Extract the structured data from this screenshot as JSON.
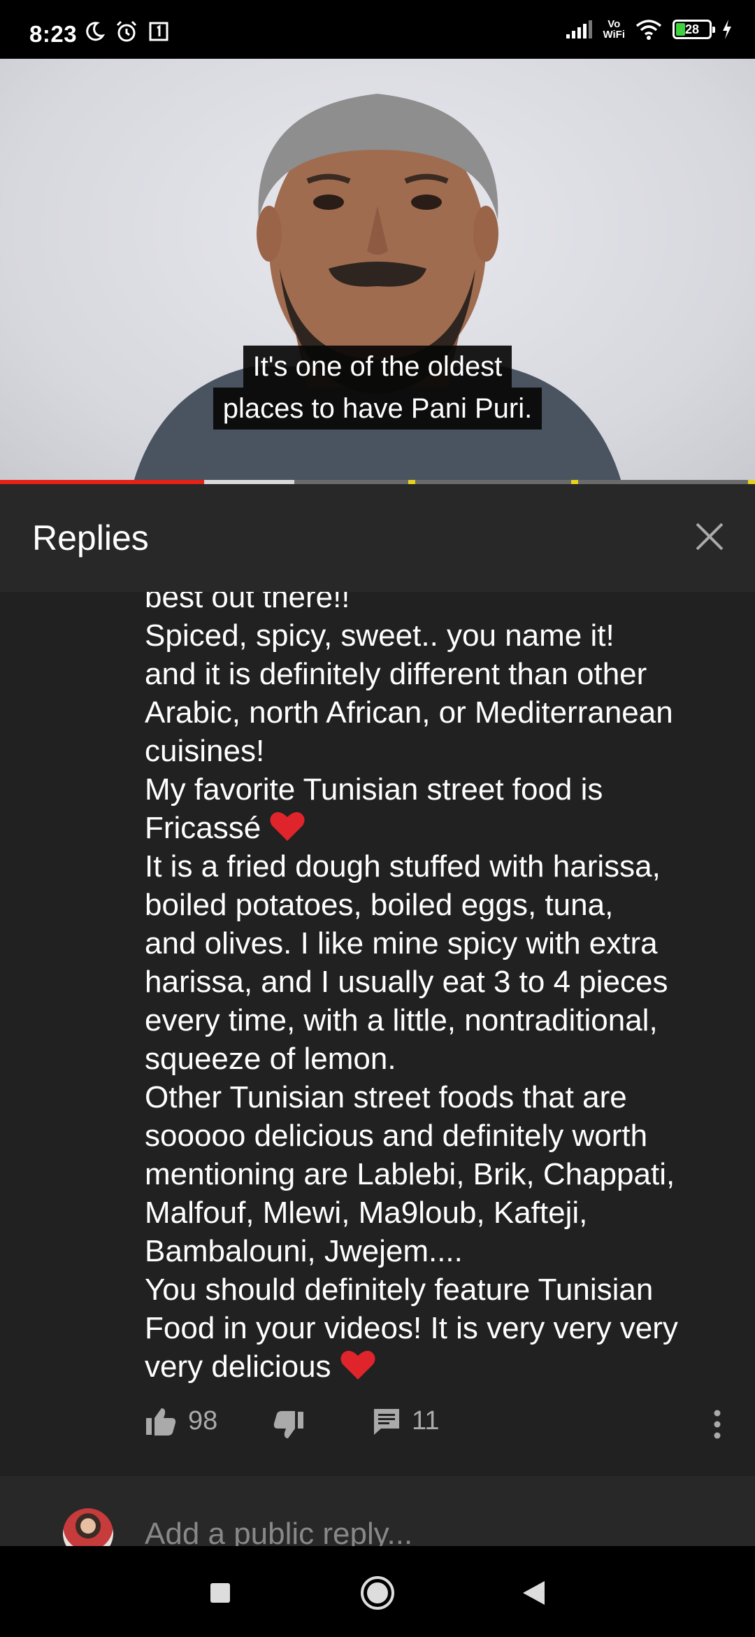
{
  "status_bar": {
    "time": "8:23",
    "vowifi_top": "Vo",
    "vowifi_bottom": "WiFi",
    "battery_level": "28",
    "icons": [
      "moon-icon",
      "alarm-icon",
      "sim-1-icon",
      "signal-icon",
      "wifi-icon",
      "battery-icon",
      "charging-icon"
    ]
  },
  "video": {
    "subtitle_line1": "It's one of the oldest",
    "subtitle_line2": "places to have Pani Puri.",
    "progress_played_fraction": 0.27,
    "progress_buffered_fraction": 0.39,
    "accent_color": "#e62117"
  },
  "replies_panel": {
    "title": "Replies",
    "close_icon": "close-icon"
  },
  "comment": {
    "lines": [
      "best out there!!",
      "Spiced, spicy, sweet.. you name it!",
      "and it is definitely different than other",
      "Arabic, north African, or Mediterranean",
      "cuisines!",
      "My favorite Tunisian street food is",
      "Fricassé",
      "It is a fried dough stuffed with harissa,",
      "boiled potatoes, boiled eggs, tuna,",
      "and olives. I like mine spicy with extra",
      "harissa, and I usually eat 3 to 4 pieces",
      "every time, with a little, nontraditional,",
      "squeeze of lemon.",
      "Other Tunisian street foods that are",
      "sooooo delicious and definitely worth",
      "mentioning are Lablebi, Brik, Chappati,",
      "Malfouf, Mlewi, Ma9loub, Kafteji,",
      "Bambalouni, Jwejem....",
      "You should definitely feature Tunisian",
      "Food in your videos! It is very very very",
      "very delicious"
    ],
    "likes": "98",
    "replies_count": "11"
  },
  "reply_input": {
    "placeholder": "Add a public reply..."
  },
  "nav": {
    "icons": [
      "recents-square-icon",
      "home-circle-icon",
      "back-triangle-icon"
    ]
  }
}
